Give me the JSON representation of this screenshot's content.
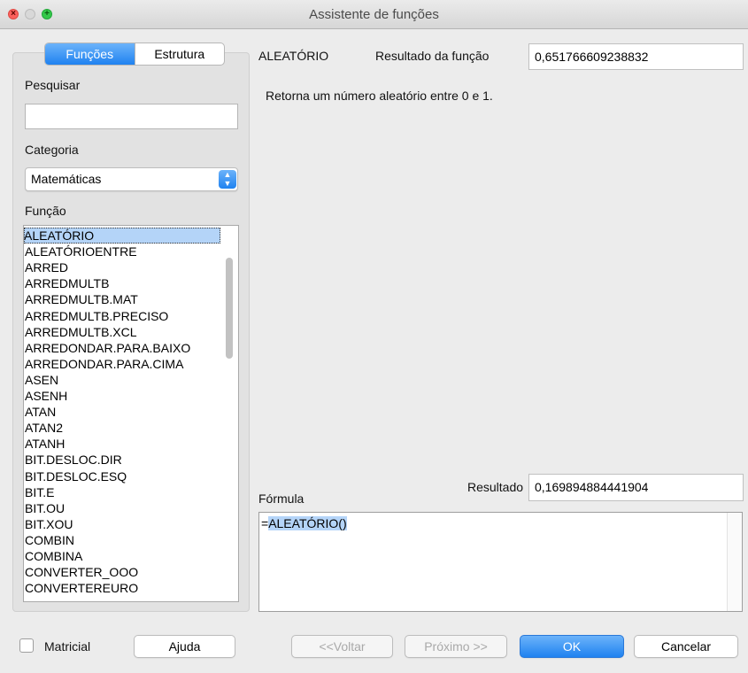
{
  "window": {
    "title": "Assistente de funções"
  },
  "tabs": [
    {
      "label": "Funções",
      "active": true
    },
    {
      "label": "Estrutura",
      "active": false
    }
  ],
  "search": {
    "label": "Pesquisar",
    "value": ""
  },
  "category": {
    "label": "Categoria",
    "value": "Matemáticas"
  },
  "function_list": {
    "label": "Função",
    "items": [
      "ALEATÓRIO",
      "ALEATÓRIOENTRE",
      "ARRED",
      "ARREDMULTB",
      "ARREDMULTB.MAT",
      "ARREDMULTB.PRECISO",
      "ARREDMULTB.XCL",
      "ARREDONDAR.PARA.BAIXO",
      "ARREDONDAR.PARA.CIMA",
      "ASEN",
      "ASENH",
      "ATAN",
      "ATAN2",
      "ATANH",
      "BIT.DESLOC.DIR",
      "BIT.DESLOC.ESQ",
      "BIT.E",
      "BIT.OU",
      "BIT.XOU",
      "COMBIN",
      "COMBINA",
      "CONVERTER_OOO",
      "CONVERTEREURO"
    ],
    "selected": "ALEATÓRIO"
  },
  "function_info": {
    "name": "ALEATÓRIO",
    "result_label": "Resultado da função",
    "result_value": "0,651766609238832",
    "description": "Retorna um número aleatório entre 0 e 1."
  },
  "formula": {
    "label": "Fórmula",
    "result_label": "Resultado",
    "result_value": "0,169894884441904",
    "prefix": "=",
    "text": "ALEATÓRIO()"
  },
  "footer": {
    "matricial_label": "Matricial",
    "matricial_checked": false,
    "help_label": "Ajuda",
    "back_label": "<<Voltar",
    "next_label": "Próximo >>",
    "ok_label": "OK",
    "cancel_label": "Cancelar"
  },
  "colors": {
    "accent": "#1f82f0",
    "selection": "#b4d4f8"
  }
}
